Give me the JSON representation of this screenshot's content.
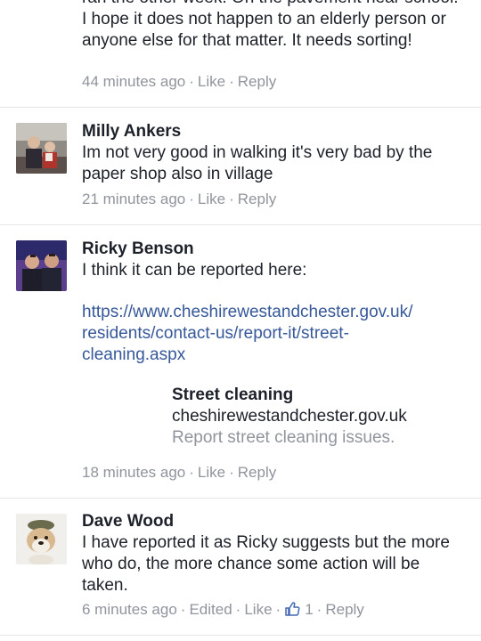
{
  "comment0": {
    "text": "ran the other week. On the pavement near school. I hope it does not happen to an elderly person or anyone else for that matter. It needs sorting!",
    "time": "44 minutes ago",
    "like": "Like",
    "reply": "Reply"
  },
  "comment1": {
    "author": "Milly Ankers",
    "text": "Im not very good in walking it's very bad by the paper shop also in  village",
    "time": "21 minutes ago",
    "like": "Like",
    "reply": "Reply"
  },
  "comment2": {
    "author": "Ricky Benson",
    "text": "I think it can be reported here:",
    "link": "https://www.cheshirewestandchester.gov.uk/residents/contact-us/report-it/street-cleaning.aspx",
    "link_lines": [
      "https://www.cheshirewestandchester.gov.uk/",
      "residents/contact-us/report-it/street-",
      "cleaning.aspx"
    ],
    "preview": {
      "title": "Street cleaning",
      "domain": "cheshirewestandchester.gov.uk",
      "description": "Report street cleaning issues."
    },
    "time": "18 minutes ago",
    "like": "Like",
    "reply": "Reply"
  },
  "comment3": {
    "author": "Dave Wood",
    "text": "I have reported it as Ricky suggests but the more who do, the more chance some action will be taken.",
    "time": "6 minutes ago",
    "edited": "Edited",
    "like": "Like",
    "like_count": "1",
    "reply": "Reply"
  },
  "colors": {
    "link": "#365899",
    "meta": "#90949c",
    "like_icon": "#4267b2"
  },
  "icons": {
    "thumbs_up": "thumbs-up-icon",
    "dot_separator": "middle-dot"
  }
}
